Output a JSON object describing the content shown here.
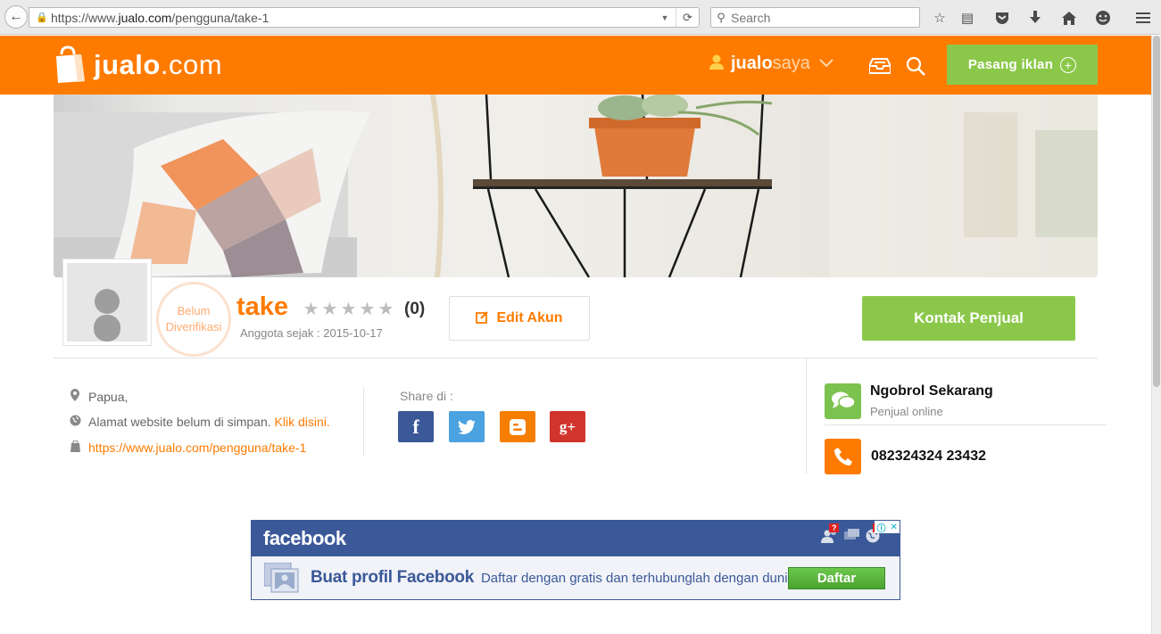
{
  "browser": {
    "url_prefix": "https://www.",
    "url_domain": "jualo.com",
    "url_path": "/pengguna/take-1",
    "search_placeholder": "Search",
    "icons": [
      "back-icon",
      "lock-icon",
      "dropdown-icon",
      "reload-icon",
      "bookmark-star-icon",
      "reading-list-icon",
      "pocket-icon",
      "download-icon",
      "home-icon",
      "emoji-icon",
      "menu-icon"
    ]
  },
  "header": {
    "logo_bold": "jualo",
    "logo_light": ".com",
    "user_bold": "jualo",
    "user_light": "saya",
    "post_button": "Pasang iklan",
    "brand_color": "#ff7b00",
    "accent_green": "#8bc84a"
  },
  "profile": {
    "verification_line1": "Belum",
    "verification_line2": "Diverifikasi",
    "username": "take",
    "rating_count": "(0)",
    "member_since": "Anggota sejak : 2015-10-17",
    "edit_button": "Edit Akun",
    "contact_button": "Kontak Penjual"
  },
  "info": {
    "location": "Papua,",
    "website_text": "Alamat website belum di simpan.",
    "website_link": "Klik disini.",
    "profile_url": "https://www.jualo.com/pengguna/take-1"
  },
  "share": {
    "label": "Share di :",
    "facebook": "f",
    "twitter": "t",
    "blogger": "B",
    "googleplus": "g+"
  },
  "sidebar": {
    "chat_title": "Ngobrol Sekarang",
    "chat_status": "Penjual online",
    "phone": "082324324 23432"
  },
  "ad": {
    "brand": "facebook",
    "headline": "Buat profil Facebook",
    "subtext": "Daftar dengan gratis dan terhubunglah dengan dunia",
    "cta": "Daftar",
    "badge": "?",
    "badge2": "1"
  }
}
